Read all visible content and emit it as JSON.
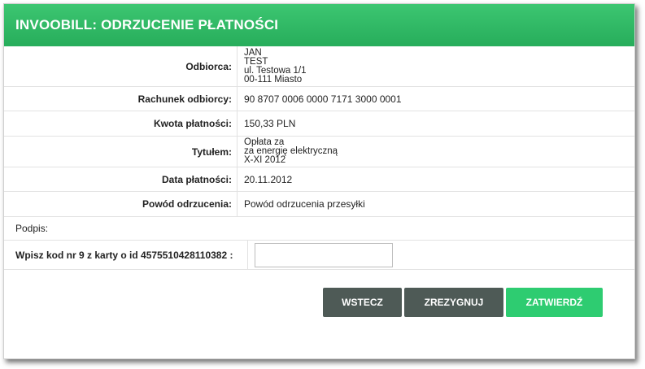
{
  "header": {
    "title": "INVOOBILL: ODRZUCENIE PŁATNOŚCI"
  },
  "rows": {
    "odbiorca": {
      "label": "Odbiorca:",
      "lines": [
        "JAN",
        "TEST",
        "ul. Testowa 1/1",
        "00-111 Miasto"
      ]
    },
    "rachunek": {
      "label": "Rachunek odbiorcy:",
      "value": "90 8707 0006 0000 7171 3000 0001"
    },
    "kwota": {
      "label": "Kwota płatności:",
      "value": "150,33 PLN"
    },
    "tytul": {
      "label": "Tytułem:",
      "lines": [
        "Opłata za",
        "za energię elektryczną",
        "X-XI 2012"
      ]
    },
    "data": {
      "label": "Data płatności:",
      "value": "20.11.2012"
    },
    "powod": {
      "label": "Powód odrzucenia:",
      "value": "Powód odrzucenia przesyłki"
    }
  },
  "podpis": {
    "label": "Podpis:"
  },
  "kod": {
    "label": "Wpisz kod nr 9 z karty o id 4575510428110382 :",
    "value": "",
    "placeholder": ""
  },
  "buttons": {
    "back": "WSTECZ",
    "cancel": "ZREZYGNUJ",
    "confirm": "ZATWIERDŹ"
  },
  "colors": {
    "header_green": "#2db865",
    "confirm_green": "#2ecc71",
    "dark_button": "#4e5a56"
  }
}
